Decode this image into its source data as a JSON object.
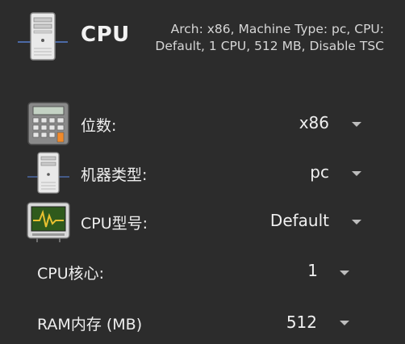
{
  "header": {
    "title": "CPU",
    "description": "Arch: x86, Machine Type: pc, CPU: Default, 1 CPU, 512 MB, Disable TSC",
    "icon": "server-tower-icon"
  },
  "settings": [
    {
      "label": "位数:",
      "value": "x86",
      "icon": "calculator-icon"
    },
    {
      "label": "机器类型:",
      "value": "pc",
      "icon": "server-tower-icon"
    },
    {
      "label": "CPU型号:",
      "value": "Default",
      "icon": "cpu-monitor-icon"
    },
    {
      "label": "CPU核心:",
      "value": "1"
    },
    {
      "label": "RAM内存 (MB)",
      "value": "512"
    }
  ],
  "colors": {
    "background": "#2c2c2c",
    "text": "#ededed",
    "arrow": "#bdbdbd"
  }
}
